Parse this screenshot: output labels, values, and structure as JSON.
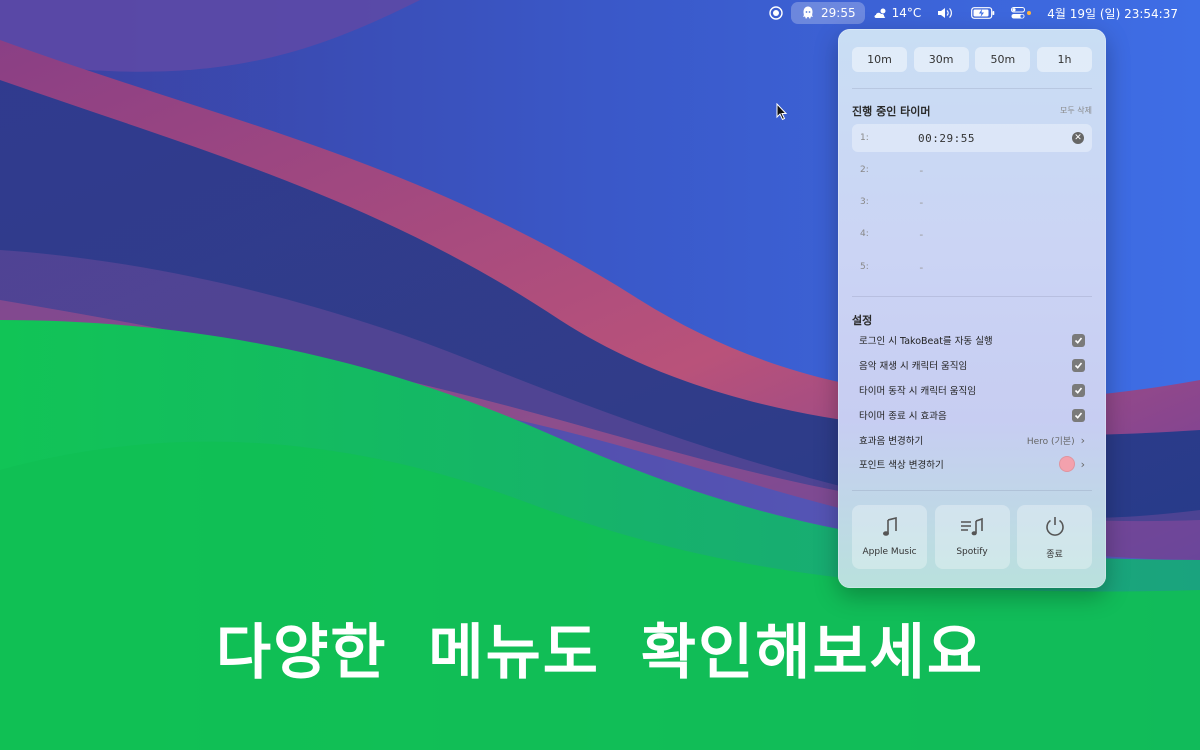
{
  "menubar": {
    "timer_text": "29:55",
    "weather_text": "14°C",
    "datetime": "4월 19일 (일) 23:54:37"
  },
  "panel": {
    "presets": [
      "10m",
      "30m",
      "50m",
      "1h"
    ],
    "running_title": "진행 중인 타이머",
    "clear_all": "모두 삭제",
    "timers": [
      {
        "index": "1:",
        "value": "00:29:55",
        "active": true
      },
      {
        "index": "2:",
        "value": "-"
      },
      {
        "index": "3:",
        "value": "-"
      },
      {
        "index": "4:",
        "value": "-"
      },
      {
        "index": "5:",
        "value": "-"
      }
    ],
    "settings_title": "설정",
    "settings": [
      {
        "label": "로그인 시 TakoBeat를 자동 실행",
        "checked": true
      },
      {
        "label": "음악 재생 시 캐릭터 움직임",
        "checked": true
      },
      {
        "label": "타이머 동작 시 캐릭터 움직임",
        "checked": true
      },
      {
        "label": "타이머 종료 시 효과음",
        "checked": true
      }
    ],
    "sound_label": "효과음 변경하기",
    "sound_value": "Hero (기본)",
    "color_label": "포인트 색상 변경하기",
    "point_color": "#f3a1ad",
    "buttons": {
      "apple_music": "Apple Music",
      "spotify": "Spotify",
      "quit": "종료"
    }
  },
  "caption": "다양한 메뉴도 확인해보세요"
}
